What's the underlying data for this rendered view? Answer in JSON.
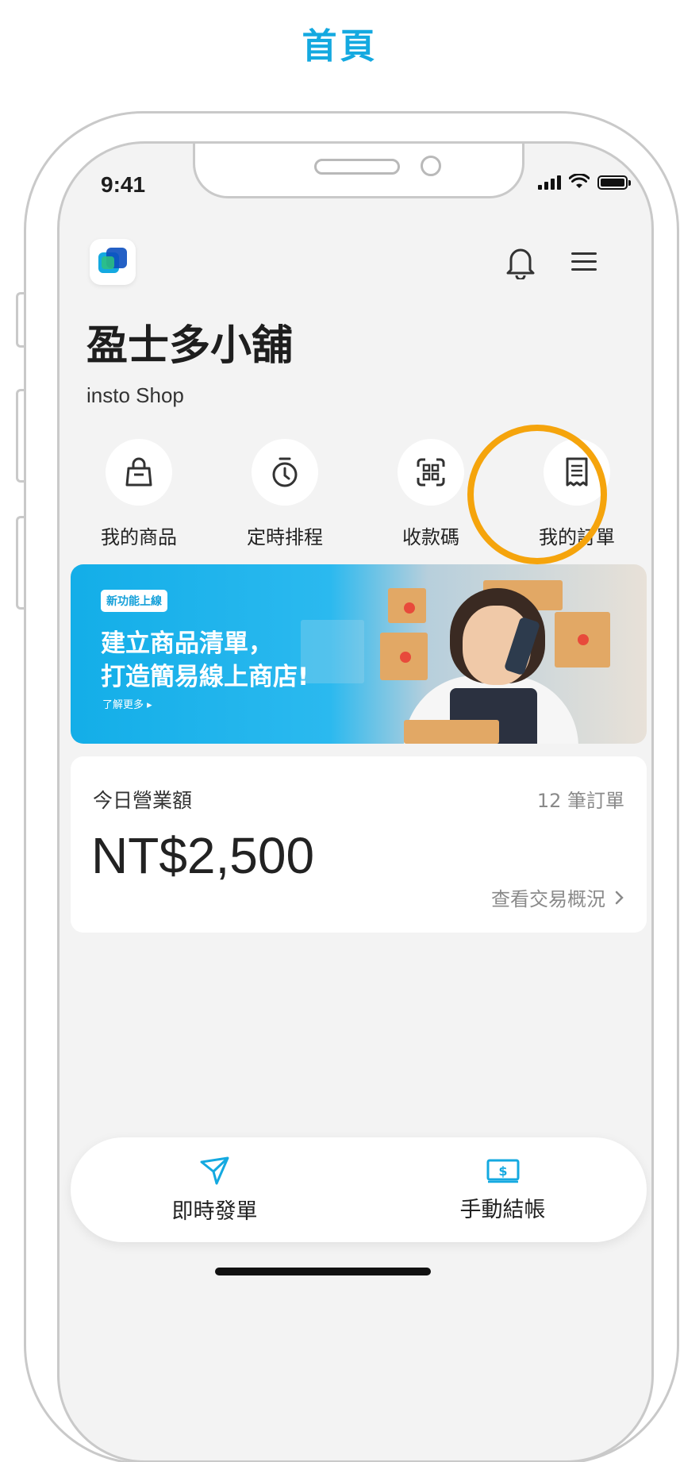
{
  "page_title": "首頁",
  "status_bar": {
    "time": "9:41"
  },
  "shop": {
    "name": "盈士多小舖",
    "subtitle": "insto Shop"
  },
  "quick_actions": [
    {
      "label": "我的商品",
      "icon": "shopping-bag-icon"
    },
    {
      "label": "定時排程",
      "icon": "stopwatch-icon"
    },
    {
      "label": "收款碼",
      "icon": "qr-scan-icon"
    },
    {
      "label": "我的訂單",
      "icon": "receipt-icon"
    }
  ],
  "banner": {
    "tag": "新功能上線",
    "line1": "建立商品清單，",
    "line2": "打造簡易線上商店!",
    "more": "了解更多 ▸"
  },
  "sales": {
    "label": "今日營業額",
    "order_count": "12 筆訂單",
    "amount": "NT$2,500",
    "link": "查看交易概況"
  },
  "bottom_actions": [
    {
      "label": "即時發單",
      "icon": "paper-plane-icon"
    },
    {
      "label": "手動結帳",
      "icon": "cash-icon"
    }
  ],
  "colors": {
    "brand": "#14a9e0",
    "highlight": "#f5a40c"
  }
}
